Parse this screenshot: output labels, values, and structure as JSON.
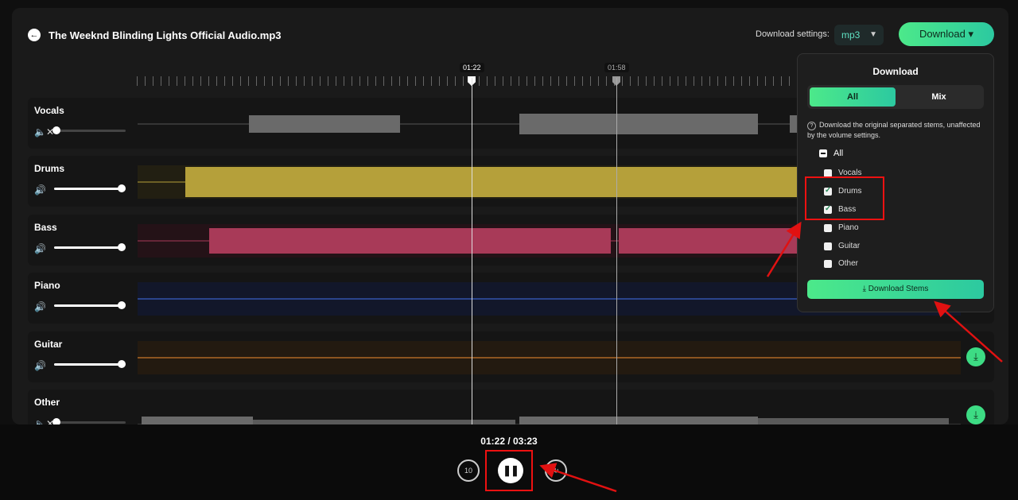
{
  "header": {
    "title": "The Weeknd Blinding Lights Official Audio.mp3",
    "download_settings_label": "Download settings:",
    "format": "mp3",
    "download_button": "Download"
  },
  "timeline": {
    "marker_current": "01:22",
    "marker_end": "01:58"
  },
  "tracks": [
    {
      "name": "Vocals",
      "volume": 0,
      "muted": true
    },
    {
      "name": "Drums",
      "volume": 1
    },
    {
      "name": "Bass",
      "volume": 1
    },
    {
      "name": "Piano",
      "volume": 1
    },
    {
      "name": "Guitar",
      "volume": 1
    },
    {
      "name": "Other",
      "volume": 0
    }
  ],
  "panel": {
    "title": "Download",
    "tab_all": "All",
    "tab_mix": "Mix",
    "note": "Download the original separated stems, unaffected by the volume settings.",
    "all_label": "All",
    "options": [
      {
        "label": "Vocals",
        "checked": false
      },
      {
        "label": "Drums",
        "checked": true
      },
      {
        "label": "Bass",
        "checked": true
      },
      {
        "label": "Piano",
        "checked": false
      },
      {
        "label": "Guitar",
        "checked": false
      },
      {
        "label": "Other",
        "checked": false
      }
    ],
    "stems_button": "Download Stems"
  },
  "player": {
    "time": "01:22 / 03:23",
    "rewind_label": "10"
  },
  "colors": {
    "accent": "#3ddc84",
    "drums": "#b5a03a",
    "bass": "#a83a58",
    "piano": "#3a5fc8",
    "guitar": "#c9782b",
    "grey": "#6a6a6a",
    "annotation": "#e11111"
  }
}
